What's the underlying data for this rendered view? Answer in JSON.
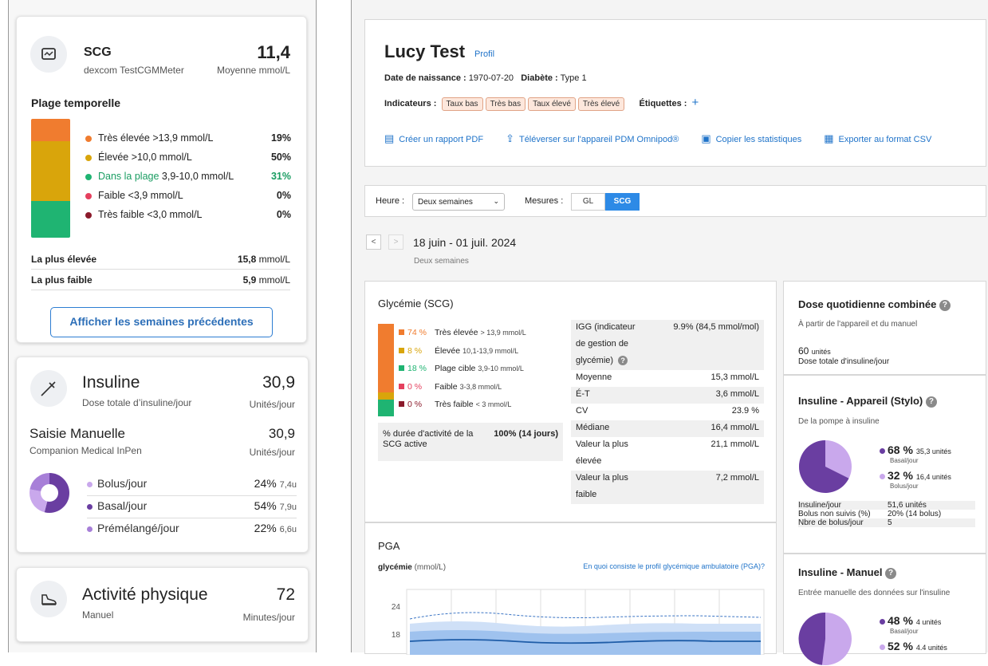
{
  "scg_card": {
    "title": "SCG",
    "device": "dexcom TestCGMMeter",
    "value": "11,4",
    "unit": "Moyenne mmol/L",
    "range_heading": "Plage temporelle",
    "ranges": [
      {
        "label": "Très élevée",
        "threshold": ">13,9 mmol/L",
        "pct": "19%",
        "color": "#f07c2f"
      },
      {
        "label": "Élevée",
        "threshold": ">10,0 mmol/L",
        "pct": "50%",
        "color": "#d9a50b"
      },
      {
        "label": "Dans la plage",
        "threshold": "3,9-10,0 mmol/L",
        "pct": "31%",
        "color": "#1fb472"
      },
      {
        "label": "Faible",
        "threshold": "<3,9 mmol/L",
        "pct": "0%",
        "color": "#e5405e"
      },
      {
        "label": "Très faible",
        "threshold": "<3,0 mmol/L",
        "pct": "0%",
        "color": "#8b1a2b"
      }
    ],
    "highest_label": "La plus élevée",
    "highest_value": "15,8",
    "highest_unit": "mmol/L",
    "lowest_label": "La plus faible",
    "lowest_value": "5,9",
    "lowest_unit": "mmol/L",
    "prev_weeks_button": "Afficher les semaines précédentes"
  },
  "insulin_card": {
    "title": "Insuline",
    "subtitle": "Dose totale d’insuline/jour",
    "value": "30,9",
    "unit": "Unités/jour",
    "manual_title": "Saisie Manuelle",
    "manual_device": "Companion Medical InPen",
    "manual_value": "30,9",
    "manual_unit": "Unités/jour",
    "items": [
      {
        "label": "Bolus/jour",
        "pct": "24%",
        "units": "7,4u",
        "color": "#c9a8ec"
      },
      {
        "label": "Basal/jour",
        "pct": "54%",
        "units": "7,9u",
        "color": "#6a3ea1"
      },
      {
        "label": "Prémélangé/jour",
        "pct": "22%",
        "units": "6,6u",
        "color": "#a77fd8"
      }
    ]
  },
  "activity_card": {
    "title": "Activité physique",
    "subtitle": "Manuel",
    "value": "72",
    "unit": "Minutes/jour"
  },
  "patient": {
    "name": "Lucy Test",
    "profile_link": "Profil",
    "dob_label": "Date de naissance :",
    "dob": "1970-07-20",
    "diabetes_label": "Diabète :",
    "diabetes": "Type 1",
    "indicators_label": "Indicateurs :",
    "indicators": [
      "Taux bas",
      "Très bas",
      "Taux élevé",
      "Très élevé"
    ],
    "tags_label": "Étiquettes :",
    "add_tag": "+",
    "actions": [
      "Créer un rapport PDF",
      "Téléverser sur l'appareil PDM Omnipod®",
      "Copier les statistiques",
      "Exporter au format CSV"
    ]
  },
  "filters": {
    "time_label": "Heure :",
    "time_value": "Deux semaines",
    "measures_label": "Mesures :",
    "measure_options": [
      "GL",
      "SCG"
    ],
    "active_measure": "SCG"
  },
  "period": {
    "prev": "<",
    "next": ">",
    "range": "18 juin - 01 juil. 2024",
    "sub": "Deux semaines"
  },
  "glycemia": {
    "title": "Glycémie (SCG)",
    "ranges": [
      {
        "pct": "74 %",
        "label": "Très élevée",
        "detail": "> 13,9 mmol/L",
        "color": "#f07c2f"
      },
      {
        "pct": "8 %",
        "label": "Élevée",
        "detail": "10,1-13,9 mmol/L",
        "color": "#d9a50b"
      },
      {
        "pct": "18 %",
        "label": "Plage cible",
        "detail": "3,9-10 mmol/L",
        "color": "#1fb472"
      },
      {
        "pct": "0 %",
        "label": "Faible",
        "detail": "3-3,8 mmol/L",
        "color": "#e5405e"
      },
      {
        "pct": "0 %",
        "label": "Très faible",
        "detail": "< 3 mmol/L",
        "color": "#8b1a2b"
      }
    ],
    "active_label": "% durée d'activité de la SCG active",
    "active_value": "100% (14 jours)",
    "stats": [
      {
        "label": "IGG (indicateur",
        "value": "9.9% (84,5 mmol/mol)"
      },
      {
        "label": "de gestion de",
        "value": ""
      },
      {
        "label": "glycémie)",
        "value": ""
      },
      {
        "label": "Moyenne",
        "value": "15,3 mmol/L"
      },
      {
        "label": "É-T",
        "value": "3,6 mmol/L"
      },
      {
        "label": "CV",
        "value": "23.9 %"
      },
      {
        "label": "Médiane",
        "value": "16,4 mmol/L"
      },
      {
        "label": "Valeur la plus",
        "value": "21,1 mmol/L"
      },
      {
        "label": "élevée",
        "value": ""
      },
      {
        "label": "Valeur la plus",
        "value": "7,2 mmol/L"
      },
      {
        "label": "faible",
        "value": ""
      }
    ]
  },
  "pga": {
    "title": "PGA",
    "axis_label": "glycémie",
    "axis_unit": "(mmol/L)",
    "help_link": "En quoi consiste le profil glycémique ambulatoire (PGA)?",
    "ticks": [
      "24",
      "18"
    ]
  },
  "dose_panel": {
    "title": "Dose quotidienne combinée",
    "subtitle": "À partir de l'appareil et du manuel",
    "value": "60",
    "unit": "unités",
    "caption": "Dose totale d'insuline/jour"
  },
  "device_panel": {
    "title": "Insuline - Appareil (Stylo)",
    "subtitle": "De la pompe à insuline",
    "basal_pct": "68 %",
    "basal_units": "35,3 unités",
    "basal_label": "Basal/jour",
    "bolus_pct": "32 %",
    "bolus_units": "16,4 unités",
    "bolus_label": "Bolus/jour",
    "rows": [
      {
        "label": "Insuline/jour",
        "value": "51,6 unités"
      },
      {
        "label": "Bolus non suivis (%)",
        "value": "20% (14 bolus)"
      },
      {
        "label": "Nbre de bolus/jour",
        "value": "5"
      }
    ]
  },
  "manual_panel": {
    "title": "Insuline - Manuel",
    "subtitle": "Entrée manuelle des données sur l'insuline",
    "basal_pct": "48 %",
    "basal_units": "4 unités",
    "basal_label": "Basal/jour",
    "bolus_pct": "52 %",
    "bolus_units": "4.4 unités"
  }
}
